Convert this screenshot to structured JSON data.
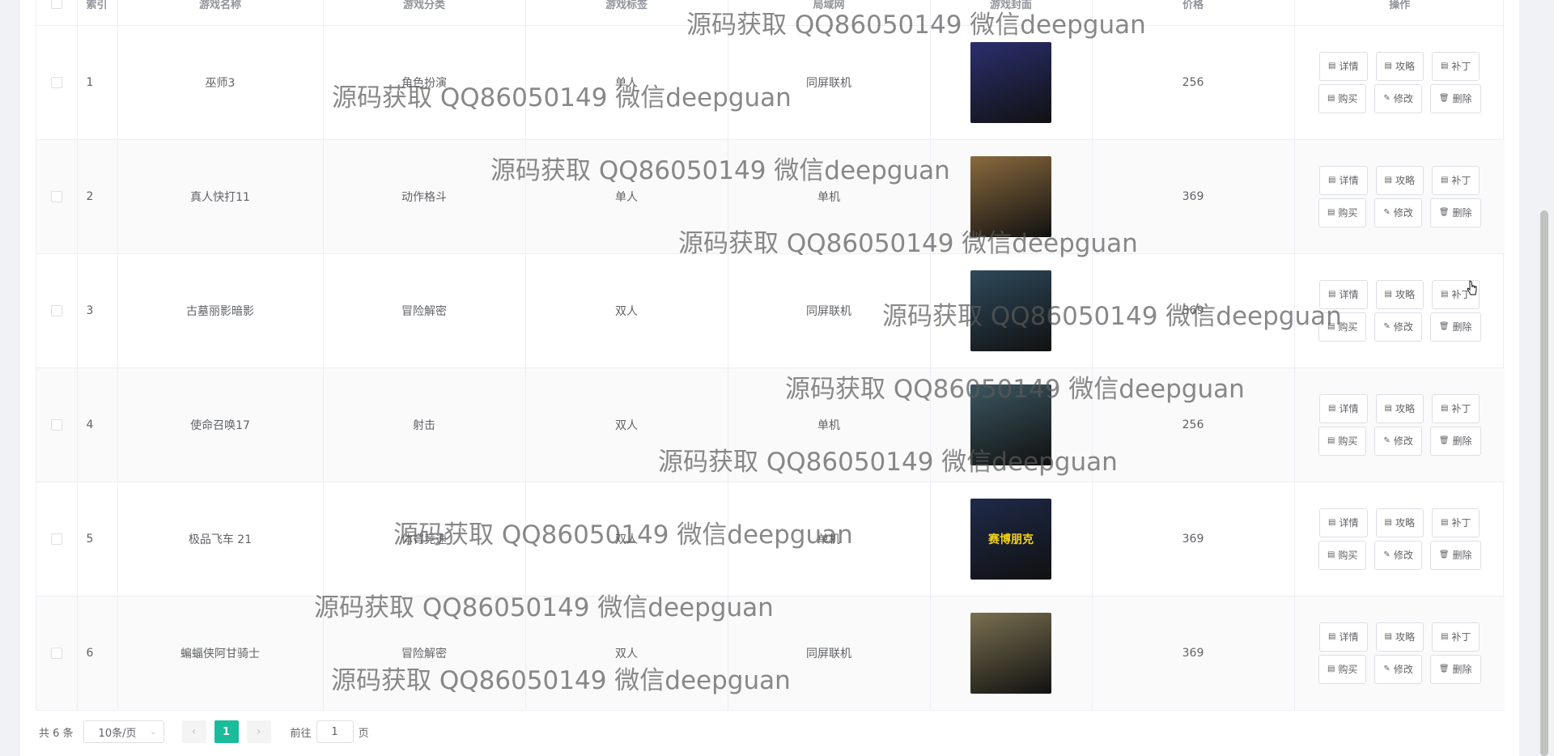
{
  "table": {
    "headers": {
      "index": "索引",
      "name": "游戏名称",
      "category": "游戏分类",
      "tag": "游戏标签",
      "network": "局域网",
      "cover": "游戏封面",
      "price": "价格",
      "actions": "操作"
    },
    "rows": [
      {
        "index": "1",
        "name": "巫师3",
        "category": "角色扮演",
        "tag": "单人",
        "network": "同屏联机",
        "price": "256",
        "cover_color": "#2a2f6e"
      },
      {
        "index": "2",
        "name": "真人快打11",
        "category": "动作格斗",
        "tag": "单人",
        "network": "单机",
        "price": "369",
        "cover_color": "#8a6a3e"
      },
      {
        "index": "3",
        "name": "古墓丽影暗影",
        "category": "冒险解密",
        "tag": "双人",
        "network": "同屏联机",
        "price": "369",
        "cover_color": "#2e4a5c"
      },
      {
        "index": "4",
        "name": "使命召唤17",
        "category": "射击",
        "tag": "双人",
        "network": "单机",
        "price": "256",
        "cover_color": "#3b5660"
      },
      {
        "index": "5",
        "name": "极品飞车 21",
        "category": "体育竞速",
        "tag": "双人",
        "network": "单机",
        "price": "369",
        "cover_color": "#1f2a4a",
        "cover_text": "赛博朋克"
      },
      {
        "index": "6",
        "name": "蝙蝠侠阿甘骑士",
        "category": "冒险解密",
        "tag": "双人",
        "network": "同屏联机",
        "price": "369",
        "cover_color": "#7a7050"
      }
    ],
    "action_labels": {
      "detail": "详情",
      "guide": "攻略",
      "patch": "补丁",
      "buy": "购买",
      "edit": "修改",
      "delete": "删除"
    }
  },
  "pagination": {
    "total_text": "共 6 条",
    "page_size": "10条/页",
    "current_page": "1",
    "goto_label": "前往",
    "goto_value": "1",
    "page_suffix": "页"
  },
  "watermark_text": "源码获取 QQ86050149 微信deepguan",
  "colors": {
    "accent": "#1abc9c",
    "border": "#ebeef5",
    "header_text": "#909399"
  },
  "icons": {
    "checkbox": "checkbox-icon",
    "document": "document-icon",
    "edit": "pencil-icon",
    "delete": "trash-icon",
    "prev": "chevron-left-icon",
    "next": "chevron-right-icon",
    "dropdown": "chevron-down-icon"
  }
}
